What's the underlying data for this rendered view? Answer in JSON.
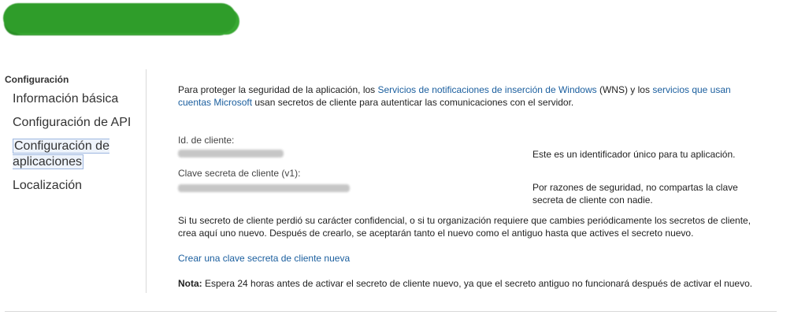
{
  "header": {
    "app_title_redacted": true
  },
  "sidebar": {
    "heading": "Configuración",
    "items": [
      {
        "label": "Información básica",
        "selected": false
      },
      {
        "label": "Configuración de API",
        "selected": false
      },
      {
        "label": "Configuración de aplicaciones",
        "selected": true
      },
      {
        "label": "Localización",
        "selected": false
      }
    ]
  },
  "main": {
    "intro": {
      "part1": "Para proteger la seguridad de la aplicación, los ",
      "link1": "Servicios de notificaciones de inserción de Windows",
      "part2": " (WNS) y los ",
      "link2": "servicios que usan cuentas Microsoft",
      "part3": " usan secretos de cliente para autenticar las comunicaciones con el servidor."
    },
    "client_id": {
      "label": "Id. de cliente:",
      "hint": "Este es un identificador único para tu aplicación."
    },
    "client_secret": {
      "label": "Clave secreta de cliente (v1):",
      "hint": "Por razones de seguridad, no compartas la clave secreta de cliente con nadie."
    },
    "reset_text": "Si tu secreto de cliente perdió su carácter confidencial, o si tu organización requiere que cambies periódicamente los secretos de cliente, crea aquí uno nuevo. Después de crearlo, se aceptarán tanto el nuevo como el antiguo hasta que actives el secreto nuevo.",
    "create_link": "Crear una clave secreta de cliente nueva",
    "note": {
      "label": "Nota:",
      "text": " Espera 24 horas antes de activar el secreto de cliente nuevo, ya que el secreto antiguo no funcionará después de activar el nuevo."
    }
  },
  "colors": {
    "link": "#1a5e9e",
    "title_scribble": "#2f9d2a"
  }
}
